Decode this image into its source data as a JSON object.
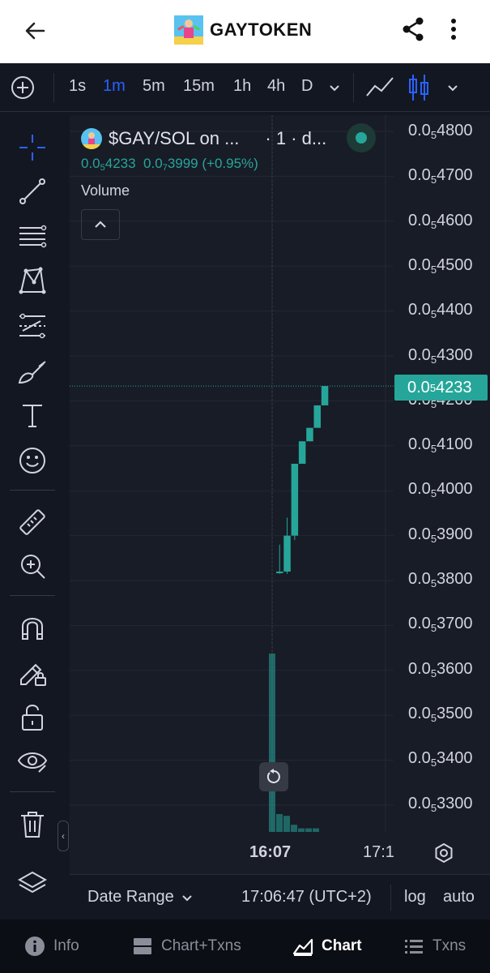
{
  "app": {
    "title": "GAYTOKEN"
  },
  "timeframes": {
    "items": [
      "1s",
      "1m",
      "5m",
      "15m",
      "1h",
      "4h",
      "D"
    ],
    "active": "1m"
  },
  "legend": {
    "symbol": "$GAY/SOL on ...",
    "interval": "· 1 · d...",
    "price_prefix": "0.0",
    "price_sub": "5",
    "price_rest": "4233",
    "change_prefix": "0.0",
    "change_sub": "7",
    "change_rest": "3999 (+0.95%)",
    "volume_label": "Volume"
  },
  "price_axis": {
    "labels": [
      {
        "prefix": "0.0",
        "sub": "5",
        "rest": "4800"
      },
      {
        "prefix": "0.0",
        "sub": "5",
        "rest": "4700"
      },
      {
        "prefix": "0.0",
        "sub": "5",
        "rest": "4600"
      },
      {
        "prefix": "0.0",
        "sub": "5",
        "rest": "4500"
      },
      {
        "prefix": "0.0",
        "sub": "5",
        "rest": "4400"
      },
      {
        "prefix": "0.0",
        "sub": "5",
        "rest": "4300"
      },
      {
        "prefix": "0.0",
        "sub": "5",
        "rest": "4200"
      },
      {
        "prefix": "0.0",
        "sub": "5",
        "rest": "4100"
      },
      {
        "prefix": "0.0",
        "sub": "5",
        "rest": "4000"
      },
      {
        "prefix": "0.0",
        "sub": "5",
        "rest": "3900"
      },
      {
        "prefix": "0.0",
        "sub": "5",
        "rest": "3800"
      },
      {
        "prefix": "0.0",
        "sub": "5",
        "rest": "3700"
      },
      {
        "prefix": "0.0",
        "sub": "5",
        "rest": "3600"
      },
      {
        "prefix": "0.0",
        "sub": "5",
        "rest": "3500"
      },
      {
        "prefix": "0.0",
        "sub": "5",
        "rest": "3400"
      },
      {
        "prefix": "0.0",
        "sub": "5",
        "rest": "3300"
      }
    ],
    "last_price": {
      "prefix": "0.0",
      "sub": "5",
      "rest": "4233"
    }
  },
  "time_axis": {
    "labels": [
      "16:07",
      "17:1"
    ]
  },
  "footer": {
    "date_range": "Date Range",
    "clock": "17:06:47 (UTC+2)",
    "log": "log",
    "auto": "auto"
  },
  "bottom_nav": {
    "info": "Info",
    "chart_txns": "Chart+Txns",
    "chart": "Chart",
    "txns": "Txns"
  },
  "colors": {
    "up": "#26a69a",
    "active_tab": "#2962ff",
    "background": "#131722"
  },
  "chart_data": {
    "type": "candlestick",
    "candles": [
      {
        "open": 3.82e-05,
        "high": 3.88e-05,
        "low": 3.815e-05,
        "close": 3.82e-05
      },
      {
        "open": 3.82e-05,
        "high": 3.94e-05,
        "low": 3.815e-05,
        "close": 3.9e-05
      },
      {
        "open": 3.9e-05,
        "high": 4.06e-05,
        "low": 3.89e-05,
        "close": 4.06e-05
      },
      {
        "open": 4.06e-05,
        "high": 4.11e-05,
        "low": 4.06e-05,
        "close": 4.11e-05
      },
      {
        "open": 4.11e-05,
        "high": 4.14e-05,
        "low": 4.11e-05,
        "close": 4.14e-05
      },
      {
        "open": 4.14e-05,
        "high": 4.19e-05,
        "low": 4.14e-05,
        "close": 4.19e-05
      },
      {
        "open": 4.19e-05,
        "high": 4.233e-05,
        "low": 4.19e-05,
        "close": 4.233e-05
      }
    ],
    "volume": [
      100,
      10,
      9,
      4,
      2,
      2,
      2
    ],
    "ylim": [
      3.3e-05,
      4.8e-05
    ],
    "last_price": 4.233e-05
  }
}
